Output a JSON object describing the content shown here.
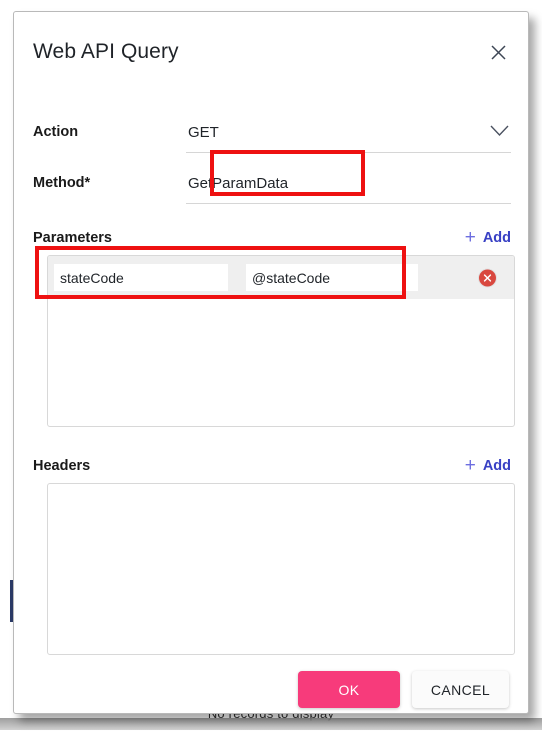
{
  "background": {
    "no_records_text": "No records to display"
  },
  "dialog": {
    "title": "Web API Query",
    "close_icon": "close-icon",
    "fields": [
      {
        "label": "Action",
        "value": "GET",
        "icon": "chevron-down-icon"
      },
      {
        "label": "Method*",
        "value": "GetParamData"
      }
    ],
    "parameters": {
      "title": "Parameters",
      "add_label": "Add",
      "add_plus": "+",
      "rows": [
        {
          "key": "stateCode",
          "value": "@stateCode",
          "delete_icon": "delete-circle-icon"
        }
      ]
    },
    "headers": {
      "title": "Headers",
      "add_label": "Add",
      "add_plus": "+",
      "rows": []
    },
    "footer": {
      "ok_label": "OK",
      "cancel_label": "CANCEL",
      "ok_color": "#f73b7b"
    }
  },
  "annotations": {
    "accent_color": "#ee1111",
    "boxes": [
      "method-field",
      "parameter-row"
    ]
  }
}
